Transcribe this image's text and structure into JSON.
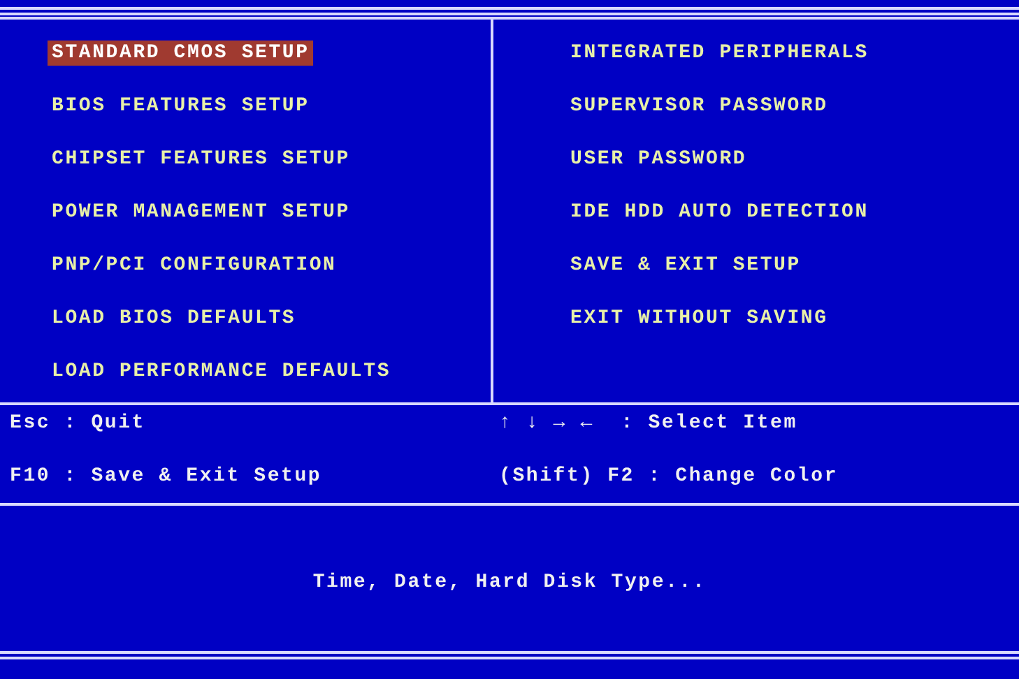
{
  "menu": {
    "left": [
      {
        "label": "STANDARD CMOS SETUP",
        "selected": true
      },
      {
        "label": "BIOS FEATURES SETUP",
        "selected": false
      },
      {
        "label": "CHIPSET FEATURES SETUP",
        "selected": false
      },
      {
        "label": "POWER MANAGEMENT SETUP",
        "selected": false
      },
      {
        "label": "PNP/PCI CONFIGURATION",
        "selected": false
      },
      {
        "label": "LOAD BIOS DEFAULTS",
        "selected": false
      },
      {
        "label": "LOAD PERFORMANCE DEFAULTS",
        "selected": false
      }
    ],
    "right": [
      {
        "label": "INTEGRATED PERIPHERALS",
        "selected": false
      },
      {
        "label": "SUPERVISOR PASSWORD",
        "selected": false
      },
      {
        "label": "USER PASSWORD",
        "selected": false
      },
      {
        "label": "IDE HDD AUTO DETECTION",
        "selected": false
      },
      {
        "label": "SAVE & EXIT SETUP",
        "selected": false
      },
      {
        "label": "EXIT WITHOUT SAVING",
        "selected": false
      }
    ]
  },
  "help": [
    "Esc : Quit",
    "↑ ↓ → ←  : Select Item",
    "F10 : Save & Exit Setup",
    "(Shift) F2 : Change Color"
  ],
  "description": "Time, Date, Hard Disk Type..."
}
